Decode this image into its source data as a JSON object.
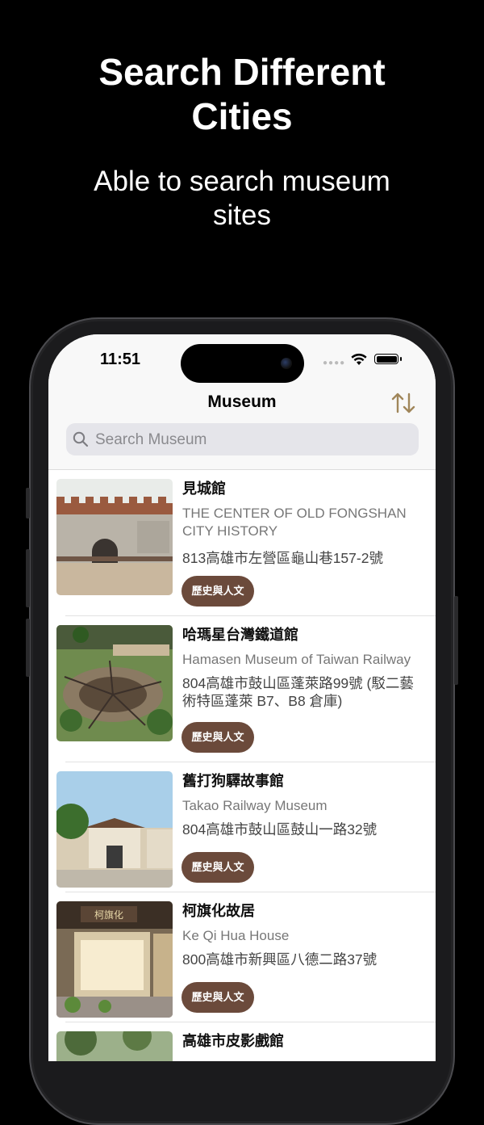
{
  "promo": {
    "title_line1": "Search Different",
    "title_line2": "Cities",
    "subtitle_line1": "Able to search museum",
    "subtitle_line2": "sites"
  },
  "status_bar": {
    "time": "11:51"
  },
  "nav": {
    "title": "Museum",
    "sort_icon": "sort-arrows-icon",
    "accent": "#a0865a"
  },
  "search": {
    "placeholder": "Search Museum",
    "value": ""
  },
  "museums": [
    {
      "name": "見城館",
      "english_line1": "THE CENTER OF OLD FONGSHAN",
      "english_line2": "CITY HISTORY",
      "address_line1": "813高雄市左營區龜山巷157-2號",
      "address_line2": "",
      "tag": "歷史與人文"
    },
    {
      "name": "哈瑪星台灣鐵道館",
      "english_line1": "Hamasen Museum of Taiwan Railway",
      "english_line2": "",
      "address_line1": "804高雄市鼓山區蓬萊路99號 (駁二藝",
      "address_line2": "術特區蓬萊 B7、B8 倉庫)",
      "tag": "歷史與人文"
    },
    {
      "name": "舊打狗驛故事館",
      "english_line1": "Takao Railway Museum",
      "english_line2": "",
      "address_line1": "804高雄市鼓山區鼓山一路32號",
      "address_line2": "",
      "tag": "歷史與人文"
    },
    {
      "name": "柯旗化故居",
      "english_line1": "Ke Qi Hua House",
      "english_line2": "",
      "address_line1": "800高雄市新興區八德二路37號",
      "address_line2": "",
      "tag": "歷史與人文"
    },
    {
      "name": "高雄市皮影戲館",
      "english_line1": "",
      "english_line2": "",
      "address_line1": "",
      "address_line2": "",
      "tag": ""
    }
  ],
  "thumb_sign": "柯旗化",
  "colors": {
    "tag_bg": "#6b4a3b",
    "search_bg": "#e5e5ea",
    "background": "#000000"
  }
}
